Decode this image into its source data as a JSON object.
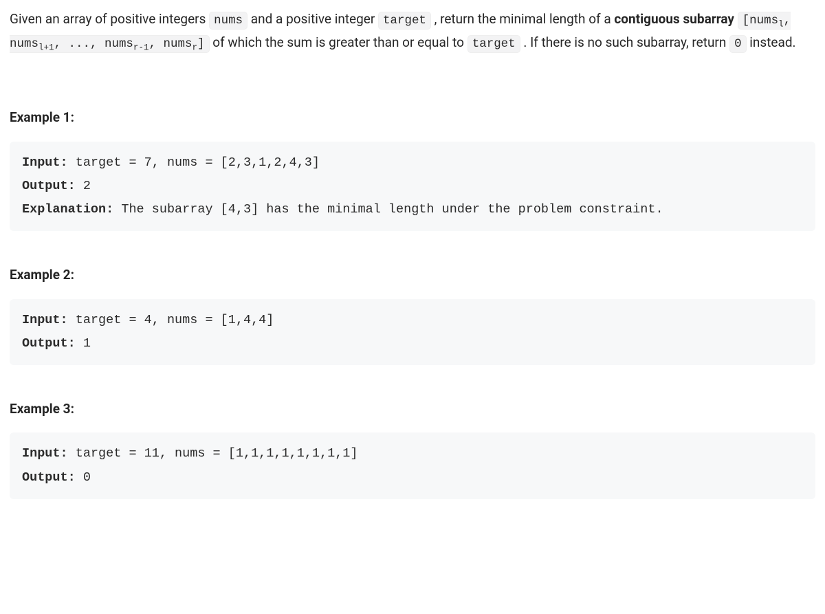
{
  "problem": {
    "p1_a": "Given an array of positive integers ",
    "p1_code1": "nums",
    "p1_b": " and a positive integer ",
    "p1_code2": "target",
    "p1_c": " , return the minimal length of a ",
    "p1_bold": "contiguous subarray",
    "p1_d": " ",
    "p1_e": " of which the sum is greater than or equal to ",
    "p1_code4": "target",
    "p1_f": " . If there is no such subarray, return ",
    "p1_code5": "0",
    "p1_g": " instead.",
    "subarray_code": {
      "open": "[nums",
      "l": "l",
      "sep": ", nums",
      "l1": "l+1",
      "dots": ", ..., nums",
      "r1": "r-1",
      "r": "r",
      "close": "]"
    }
  },
  "examples": [
    {
      "heading": "Example 1:",
      "input_label": "Input:",
      "input_value": " target = 7, nums = [2,3,1,2,4,3]",
      "output_label": "Output:",
      "output_value": " 2",
      "explanation_label": "Explanation:",
      "explanation_value": " The subarray [4,3] has the minimal length under the problem constraint."
    },
    {
      "heading": "Example 2:",
      "input_label": "Input:",
      "input_value": " target = 4, nums = [1,4,4]",
      "output_label": "Output:",
      "output_value": " 1"
    },
    {
      "heading": "Example 3:",
      "input_label": "Input:",
      "input_value": " target = 11, nums = [1,1,1,1,1,1,1,1]",
      "output_label": "Output:",
      "output_value": " 0"
    }
  ]
}
